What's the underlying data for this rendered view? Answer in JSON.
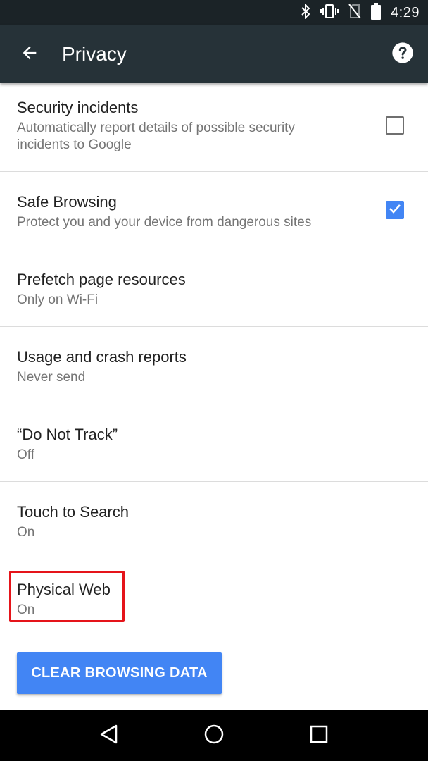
{
  "status_bar": {
    "time": "4:29",
    "icons": [
      "bluetooth-icon",
      "vibrate-icon",
      "no-sim-icon",
      "battery-icon"
    ]
  },
  "app_bar": {
    "title": "Privacy",
    "back_icon": "arrow-back-icon",
    "help_icon": "help-icon"
  },
  "preferences": [
    {
      "title": "Security incidents",
      "summary": "Automatically report details of possible security incidents to Google",
      "checkbox": "unchecked"
    },
    {
      "title": "Safe Browsing",
      "summary": "Protect you and your device from dangerous sites",
      "checkbox": "checked"
    },
    {
      "title": "Prefetch page resources",
      "summary": "Only on Wi-Fi"
    },
    {
      "title": "Usage and crash reports",
      "summary": "Never send"
    },
    {
      "title": "“Do Not Track”",
      "summary": "Off"
    },
    {
      "title": "Touch to Search",
      "summary": "On"
    },
    {
      "title": "Physical Web",
      "summary": "On",
      "highlighted": true
    }
  ],
  "clear_button": {
    "label": "CLEAR BROWSING DATA"
  },
  "nav_bar": {
    "icons": [
      "nav-back-icon",
      "nav-home-icon",
      "nav-recents-icon"
    ]
  },
  "colors": {
    "app_bar": "#263238",
    "status_bar": "#1b2327",
    "accent": "#4285f4",
    "highlight": "#e5141a"
  }
}
